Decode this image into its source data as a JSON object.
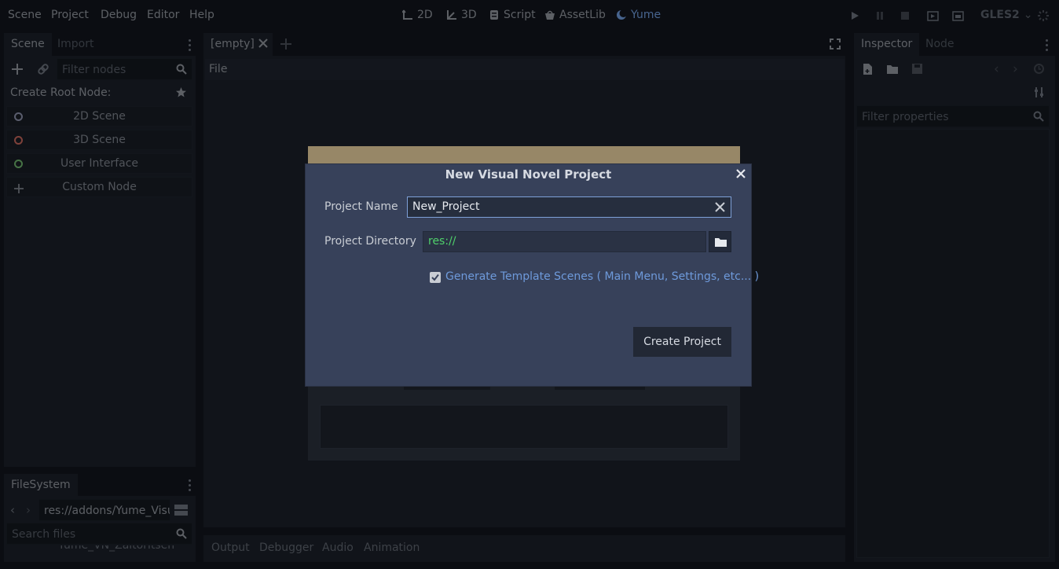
{
  "menu": [
    "Scene",
    "Project",
    "Debug",
    "Editor",
    "Help"
  ],
  "workspaces": [
    {
      "label": "2D",
      "icon": "2d-icon"
    },
    {
      "label": "3D",
      "icon": "3d-icon"
    },
    {
      "label": "Script",
      "icon": "script-icon"
    },
    {
      "label": "AssetLib",
      "icon": "assetlib-icon"
    },
    {
      "label": "Yume",
      "icon": "moon-icon"
    }
  ],
  "renderer": "GLES2",
  "scene_dock": {
    "tabs": [
      "Scene",
      "Import"
    ],
    "filter_placeholder": "Filter nodes",
    "create_root_label": "Create Root Node:",
    "root_nodes": [
      {
        "label": "2D Scene",
        "color": "#8a8fa8"
      },
      {
        "label": "3D Scene",
        "color": "#c2655a"
      },
      {
        "label": "User Interface",
        "color": "#6cb06a"
      },
      {
        "label": "Custom Node",
        "color": "#7c818a"
      }
    ]
  },
  "filesystem_dock": {
    "tab": "FileSystem",
    "path": "res://addons/Yume_Visu",
    "search_placeholder": "Search files",
    "partial_item": "Yume_VN_Zaitoritsen"
  },
  "editor": {
    "tab_label": "[empty]",
    "file_menu": "File"
  },
  "bottom_tabs": [
    "Output",
    "Debugger",
    "Audio",
    "Animation"
  ],
  "inspector": {
    "tabs": [
      "Inspector",
      "Node"
    ],
    "filter_placeholder": "Filter properties"
  },
  "dialog": {
    "title": "New Visual Novel Project",
    "project_name_label": "Project Name",
    "project_name_value": "New_Project",
    "project_dir_label": "Project Directory",
    "project_dir_value": "res://",
    "checkbox_label": "Generate Template Scenes ( Main Menu, Settings, etc... )",
    "checkbox_checked": true,
    "create_button": "Create Project"
  },
  "colors": {
    "accent": "#6e9adb",
    "path_green": "#4fd16b"
  }
}
